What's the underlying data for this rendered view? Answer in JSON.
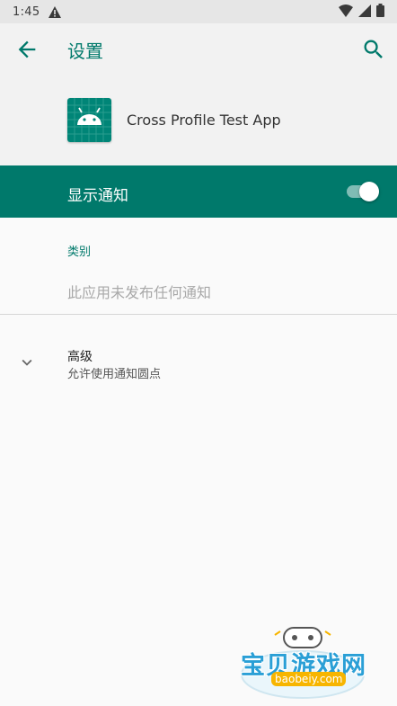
{
  "status_bar": {
    "time": "1:45",
    "icons": [
      "warning-icon",
      "wifi-icon",
      "cellular-icon",
      "battery-icon"
    ]
  },
  "app_bar": {
    "title": "设置",
    "back_icon": "arrow-back-icon",
    "search_icon": "search-icon"
  },
  "app_info": {
    "name": "Cross Profile Test App",
    "icon": "android-icon"
  },
  "master_switch": {
    "label": "显示通知",
    "checked": true
  },
  "category_section": {
    "header": "类别",
    "empty_text": "此应用未发布任何通知"
  },
  "advanced": {
    "title": "高级",
    "summary": "允许使用通知圆点",
    "icon": "chevron-down-icon"
  },
  "watermark": {
    "text": "宝贝游戏网",
    "url": "baobeiy.com"
  },
  "colors": {
    "accent": "#00796b",
    "background": "#fafafa",
    "toggle_track": "#80bcb5"
  }
}
